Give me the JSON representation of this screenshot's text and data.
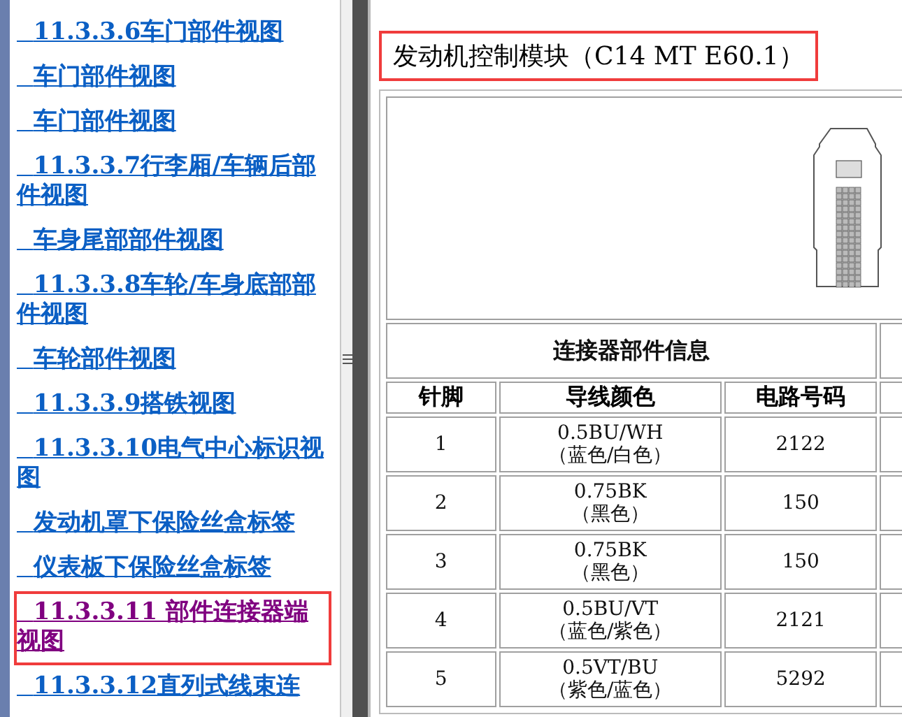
{
  "sidebar": {
    "items": [
      {
        "label": "11.3.3.6车门部件视图",
        "selected": false
      },
      {
        "label": "车门部件视图",
        "selected": false
      },
      {
        "label": "车门部件视图",
        "selected": false
      },
      {
        "label": "11.3.3.7行李厢/车辆后部件视图",
        "selected": false
      },
      {
        "label": "车身尾部部件视图",
        "selected": false
      },
      {
        "label": "11.3.3.8车轮/车身底部部件视图",
        "selected": false
      },
      {
        "label": "车轮部件视图",
        "selected": false
      },
      {
        "label": "11.3.3.9搭铁视图",
        "selected": false
      },
      {
        "label": "11.3.3.10电气中心标识视图",
        "selected": false
      },
      {
        "label": "发动机罩下保险丝盒标签",
        "selected": false
      },
      {
        "label": "仪表板下保险丝盒标签",
        "selected": false
      },
      {
        "label": "11.3.3.11 部件连接器端视图",
        "selected": true
      },
      {
        "label": "11.3.3.12直列式线束连",
        "selected": false
      }
    ]
  },
  "content": {
    "title": "发动机控制模块（C14 MT E60.1）",
    "table": {
      "section_label": "连接器部件信息",
      "columns": [
        "针脚",
        "导线颜色",
        "电路号码"
      ],
      "rows": [
        {
          "pin": "1",
          "wire": "0.5BU/WH",
          "wire_note": "（蓝色/白色）",
          "circuit": "2122"
        },
        {
          "pin": "2",
          "wire": "0.75BK",
          "wire_note": "（黑色）",
          "circuit": "150"
        },
        {
          "pin": "3",
          "wire": "0.75BK",
          "wire_note": "（黑色）",
          "circuit": "150"
        },
        {
          "pin": "4",
          "wire": "0.5BU/VT",
          "wire_note": "（蓝色/紫色）",
          "circuit": "2121"
        },
        {
          "pin": "5",
          "wire": "0.5VT/BU",
          "wire_note": "（紫色/蓝色）",
          "circuit": "5292"
        }
      ]
    }
  }
}
